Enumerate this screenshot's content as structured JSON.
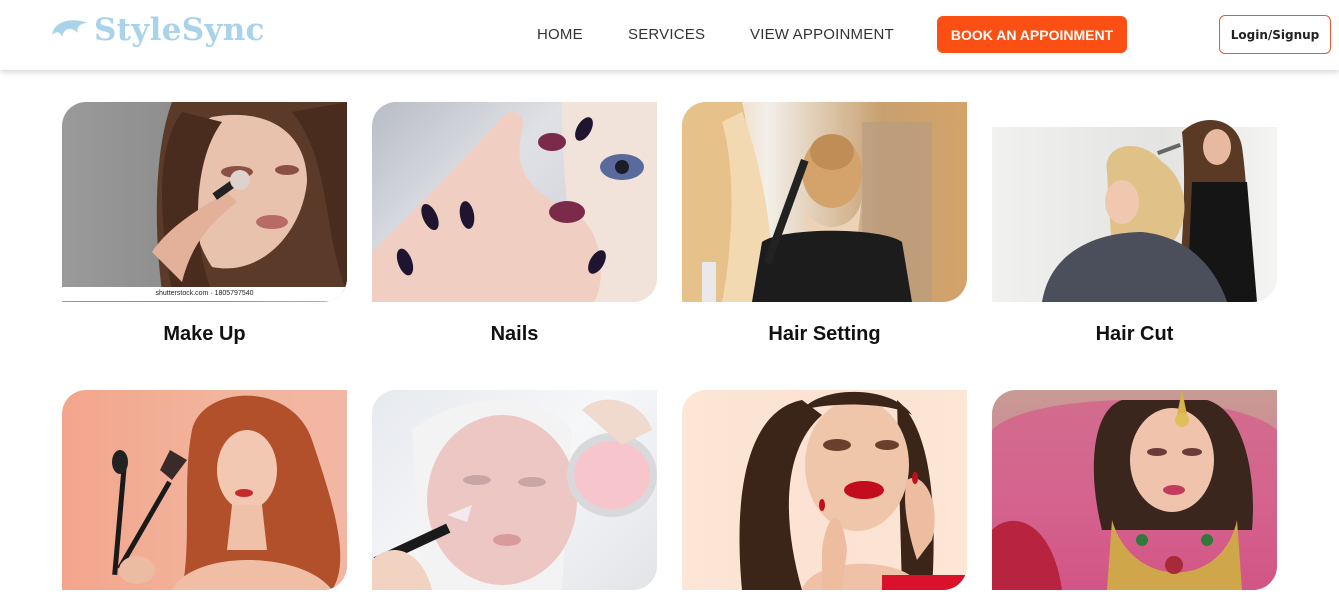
{
  "brand": {
    "name": "StyleSync",
    "logo_icon": "hair-swoosh-icon",
    "color": "#a9d3ea"
  },
  "nav": {
    "home": "HOME",
    "services": "SERVICES",
    "view_appointment": "VIEW APPOINMENT",
    "book": "BOOK AN APPOINMENT",
    "login": "Login/Signup"
  },
  "colors": {
    "accent": "#fb4f14",
    "login_border": "#e8582a"
  },
  "services": [
    {
      "title": "Make Up",
      "image": "woman-applying-makeup-brush",
      "caption": "shutterstock.com · 1805797540"
    },
    {
      "title": "Nails",
      "image": "dark-manicured-nails"
    },
    {
      "title": "Hair Setting",
      "image": "stylist-styling-updo"
    },
    {
      "title": "Hair Cut",
      "image": "stylist-cutting-hair"
    },
    {
      "title": "",
      "image": "redhead-with-makeup-brushes"
    },
    {
      "title": "",
      "image": "facial-mask-treatment"
    },
    {
      "title": "",
      "image": "glam-makeup-red-lips"
    },
    {
      "title": "",
      "image": "bridal-makeup"
    }
  ]
}
